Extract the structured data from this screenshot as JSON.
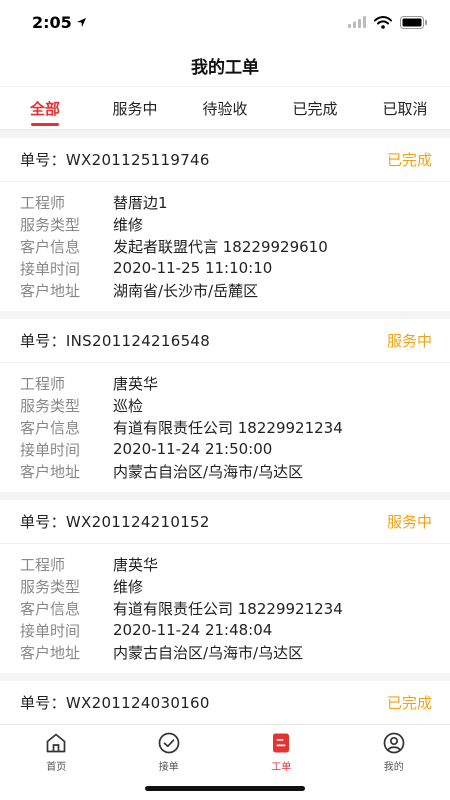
{
  "status_bar": {
    "time": "2:05"
  },
  "header": {
    "title": "我的工单"
  },
  "tabs": [
    {
      "label": "全部",
      "active": true
    },
    {
      "label": "服务中"
    },
    {
      "label": "待验收"
    },
    {
      "label": "已完成"
    },
    {
      "label": "已取消"
    }
  ],
  "field_labels": {
    "order_no": "单号：",
    "engineer": "工程师",
    "service_type": "服务类型",
    "customer_info": "客户信息",
    "accept_time": "接单时间",
    "customer_address": "客户地址"
  },
  "orders": [
    {
      "order_no": "WX201125119746",
      "status": "已完成",
      "engineer": "替厝边1",
      "service_type": "维修",
      "customer_info": "发起者联盟代言 18229929610",
      "accept_time": "2020-11-25 11:10:10",
      "customer_address": "湖南省/长沙市/岳麓区"
    },
    {
      "order_no": "INS201124216548",
      "status": "服务中",
      "engineer": "唐英华",
      "service_type": "巡检",
      "customer_info": "有道有限责任公司 18229921234",
      "accept_time": "2020-11-24 21:50:00",
      "customer_address": "内蒙古自治区/乌海市/乌达区"
    },
    {
      "order_no": "WX201124210152",
      "status": "服务中",
      "engineer": "唐英华",
      "service_type": "维修",
      "customer_info": "有道有限责任公司 18229921234",
      "accept_time": "2020-11-24 21:48:04",
      "customer_address": "内蒙古自治区/乌海市/乌达区"
    },
    {
      "order_no": "WX201124030160",
      "status": "已完成"
    }
  ],
  "bottom_tabs": [
    {
      "label": "首页",
      "icon": "home-icon"
    },
    {
      "label": "接单",
      "icon": "check-circle-icon"
    },
    {
      "label": "工单",
      "icon": "work-order-icon",
      "active": true
    },
    {
      "label": "我的",
      "icon": "user-icon"
    }
  ],
  "colors": {
    "accent": "#e53232",
    "status_orange": "#f0a316",
    "label_gray": "#888888",
    "background": "#f4f4f4"
  }
}
